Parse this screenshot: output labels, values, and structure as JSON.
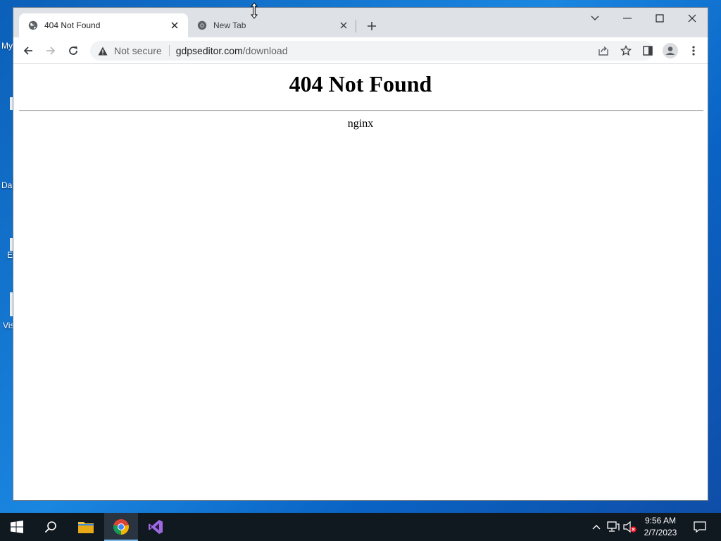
{
  "desktop": {
    "icon_labels": [
      "My",
      "Da",
      "E",
      "Vis"
    ]
  },
  "browser": {
    "tabs": [
      {
        "title": "404 Not Found",
        "favicon": "globe-icon",
        "active": true
      },
      {
        "title": "New Tab",
        "favicon": "chrome-icon",
        "active": false
      }
    ],
    "address": {
      "security_label": "Not secure",
      "host": "gdpseditor.com",
      "path": "/download"
    }
  },
  "page": {
    "heading": "404 Not Found",
    "server": "nginx"
  },
  "taskbar": {
    "time": "9:56 AM",
    "date": "2/7/2023"
  },
  "colors": {
    "taskbar": "#101820",
    "tabstrip": "#dee1e6",
    "omnibox": "#f1f3f4",
    "desktop": "#1a86e0"
  }
}
